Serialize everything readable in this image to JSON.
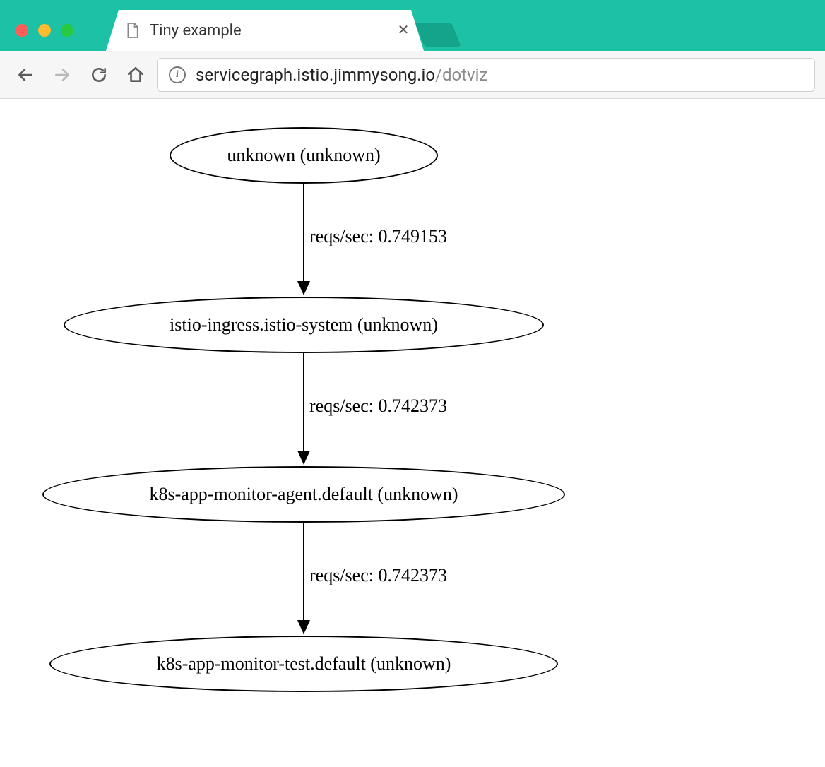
{
  "browser": {
    "tab_title": "Tiny example",
    "url_host": "servicegraph.istio.jimmysong.io",
    "url_path": "/dotviz"
  },
  "graph": {
    "nodes": [
      {
        "id": "n0",
        "label": "unknown (unknown)"
      },
      {
        "id": "n1",
        "label": "istio-ingress.istio-system (unknown)"
      },
      {
        "id": "n2",
        "label": "k8s-app-monitor-agent.default (unknown)"
      },
      {
        "id": "n3",
        "label": "k8s-app-monitor-test.default (unknown)"
      }
    ],
    "edges": [
      {
        "from": "n0",
        "to": "n1",
        "label": "reqs/sec: 0.749153"
      },
      {
        "from": "n1",
        "to": "n2",
        "label": "reqs/sec: 0.742373"
      },
      {
        "from": "n2",
        "to": "n3",
        "label": "reqs/sec: 0.742373"
      }
    ]
  }
}
